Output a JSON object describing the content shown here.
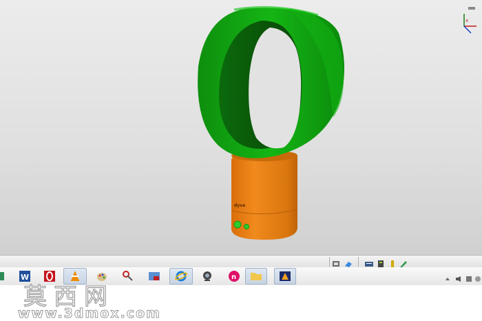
{
  "viewport": {
    "background_top": "#ececec",
    "background_bottom": "#d0d0d0",
    "model": {
      "ring_color": "#0b9a0b",
      "ring_dark": "#0a5a0a",
      "base_color": "#e07a12",
      "base_dark": "#b85e08",
      "brand_label": "dyva",
      "button_color": "#27c427"
    }
  },
  "taskbar": {
    "items": [
      {
        "icon": "app-icon",
        "active": false
      },
      {
        "icon": "word-icon",
        "active": false
      },
      {
        "icon": "opera-icon",
        "active": false
      },
      {
        "icon": "vlc-icon",
        "active": true
      },
      {
        "icon": "paint-icon",
        "active": false
      },
      {
        "icon": "tools-icon",
        "active": false
      },
      {
        "icon": "image-viewer-icon",
        "active": false
      },
      {
        "icon": "ie-icon",
        "active": false
      },
      {
        "icon": "webcam-icon",
        "active": false
      },
      {
        "icon": "n-app-icon",
        "active": false
      },
      {
        "icon": "folder-icon",
        "active": false
      },
      {
        "icon": "graphics-icon",
        "active": false
      }
    ]
  },
  "tray": {
    "icons": [
      "sync-icon",
      "eraser-icon",
      "keyboard-icon",
      "network-icon",
      "usb-icon",
      "pen-icon"
    ]
  },
  "watermark": {
    "cn": "莫西网",
    "url": "www.3dmox.com"
  }
}
